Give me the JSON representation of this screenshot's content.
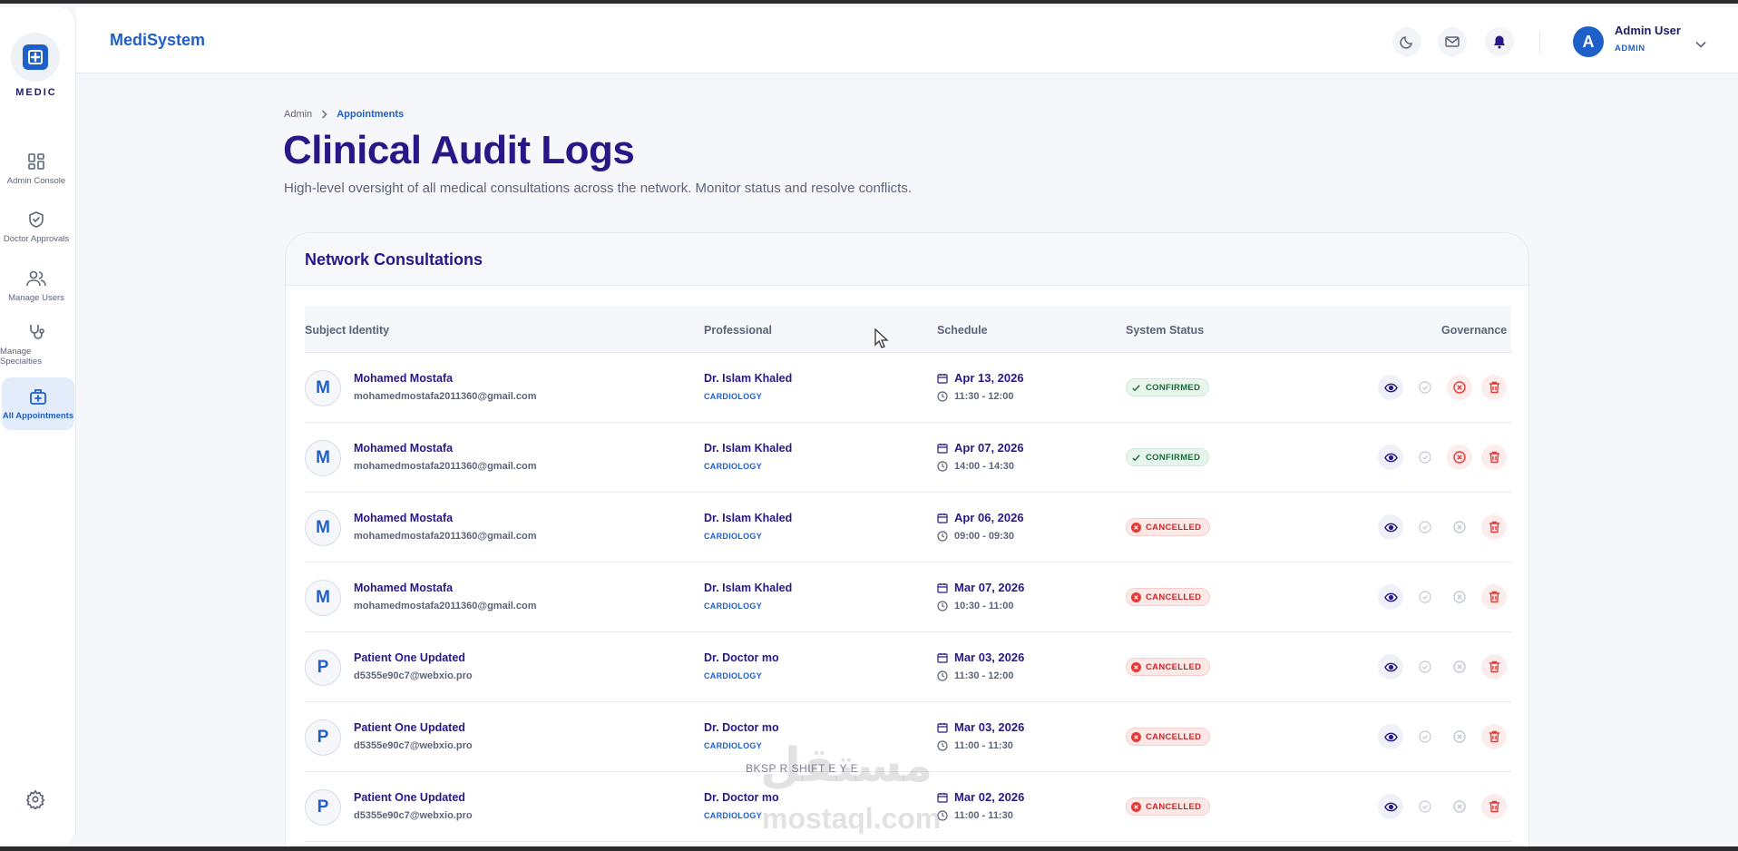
{
  "app": {
    "brand": "MediSystem",
    "logo_text": "MEDIC",
    "accent": "#1f5fc8",
    "title_color": "#2a1787"
  },
  "sidebar": {
    "items": [
      {
        "label": "Admin Console",
        "icon": "grid-icon"
      },
      {
        "label": "Doctor Approvals",
        "icon": "shield-check-icon"
      },
      {
        "label": "Manage Users",
        "icon": "users-icon"
      },
      {
        "label": "Manage Specialties",
        "icon": "stethoscope-icon"
      },
      {
        "label": "All Appointments",
        "icon": "medical-bag-icon",
        "active": true
      }
    ],
    "settings_icon": "gear-icon"
  },
  "header": {
    "icons": [
      "moon-icon",
      "mail-icon",
      "bell-icon"
    ],
    "user_initial": "A",
    "user_name": "Admin User",
    "user_role": "ADMIN"
  },
  "breadcrumb": {
    "root": "Admin",
    "current": "Appointments"
  },
  "page": {
    "title": "Clinical Audit Logs",
    "subtitle": "High-level oversight of all medical consultations across the network. Monitor status and resolve conflicts."
  },
  "card": {
    "title": "Network Consultations",
    "columns": [
      "Subject Identity",
      "Professional",
      "Schedule",
      "System Status",
      "Governance"
    ],
    "rows": [
      {
        "initial": "M",
        "name": "Mohamed Mostafa",
        "email": "mohamedmostafa2011360@gmail.com",
        "doctor": "Dr. Islam Khaled",
        "specialty": "CARDIOLOGY",
        "date": "Apr 13, 2026",
        "time": "11:30 - 12:00",
        "status": "CONFIRMED"
      },
      {
        "initial": "M",
        "name": "Mohamed Mostafa",
        "email": "mohamedmostafa2011360@gmail.com",
        "doctor": "Dr. Islam Khaled",
        "specialty": "CARDIOLOGY",
        "date": "Apr 07, 2026",
        "time": "14:00 - 14:30",
        "status": "CONFIRMED"
      },
      {
        "initial": "M",
        "name": "Mohamed Mostafa",
        "email": "mohamedmostafa2011360@gmail.com",
        "doctor": "Dr. Islam Khaled",
        "specialty": "CARDIOLOGY",
        "date": "Apr 06, 2026",
        "time": "09:00 - 09:30",
        "status": "CANCELLED"
      },
      {
        "initial": "M",
        "name": "Mohamed Mostafa",
        "email": "mohamedmostafa2011360@gmail.com",
        "doctor": "Dr. Islam Khaled",
        "specialty": "CARDIOLOGY",
        "date": "Mar 07, 2026",
        "time": "10:30 - 11:00",
        "status": "CANCELLED"
      },
      {
        "initial": "P",
        "name": "Patient One Updated",
        "email": "d5355e90c7@webxio.pro",
        "doctor": "Dr. Doctor mo",
        "specialty": "CARDIOLOGY",
        "date": "Mar 03, 2026",
        "time": "11:30 - 12:00",
        "status": "CANCELLED"
      },
      {
        "initial": "P",
        "name": "Patient One Updated",
        "email": "d5355e90c7@webxio.pro",
        "doctor": "Dr. Doctor mo",
        "specialty": "CARDIOLOGY",
        "date": "Mar 03, 2026",
        "time": "11:00 - 11:30",
        "status": "CANCELLED"
      },
      {
        "initial": "P",
        "name": "Patient One Updated",
        "email": "d5355e90c7@webxio.pro",
        "doctor": "Dr. Doctor mo",
        "specialty": "CARDIOLOGY",
        "date": "Mar 02, 2026",
        "time": "11:00 - 11:30",
        "status": "CANCELLED"
      }
    ]
  },
  "overlay": {
    "keys": "BKSP    R SHIFT     E          Y          E",
    "watermark_main": "مستقل",
    "watermark_sub": "mostaql.com"
  }
}
